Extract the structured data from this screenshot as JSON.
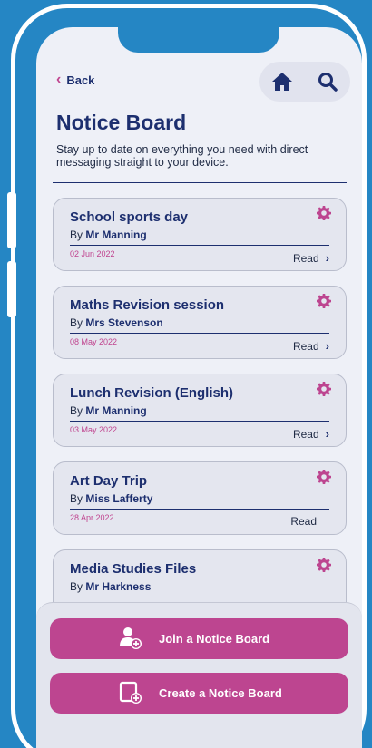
{
  "nav": {
    "back_label": "Back",
    "back_chevron": "‹"
  },
  "header": {
    "title": "Notice Board",
    "subtitle": "Stay up to date on everything you need with direct messaging straight to your device."
  },
  "icons": {
    "home": "home-icon",
    "search": "search-icon",
    "settings": "gear-icon"
  },
  "colors": {
    "background": "#2586c4",
    "accent": "#bd4590",
    "primary_text": "#1d2f6f",
    "date": "#c0448f",
    "screen": "#eef0f7"
  },
  "notices": [
    {
      "title": "School sports day",
      "by_prefix": "By",
      "author": "Mr Manning",
      "date": "02 Jun 2022",
      "read_label": "Read",
      "has_arrow": true
    },
    {
      "title": "Maths Revision session",
      "by_prefix": "By",
      "author": "Mrs Stevenson",
      "date": "08 May 2022",
      "read_label": "Read",
      "has_arrow": true
    },
    {
      "title": "Lunch Revision (English)",
      "by_prefix": "By",
      "author": "Mr Manning",
      "date": "03 May 2022",
      "read_label": "Read",
      "has_arrow": true
    },
    {
      "title": "Art Day Trip",
      "by_prefix": "By",
      "author": "Miss Lafferty",
      "date": "28 Apr 2022",
      "read_label": "Read",
      "has_arrow": false
    },
    {
      "title": "Media Studies Files",
      "by_prefix": "By",
      "author": "Mr Harkness",
      "date": "",
      "read_label": "",
      "has_arrow": false
    }
  ],
  "actions": {
    "join_label": "Join a Notice Board",
    "create_label": "Create a Notice Board"
  }
}
